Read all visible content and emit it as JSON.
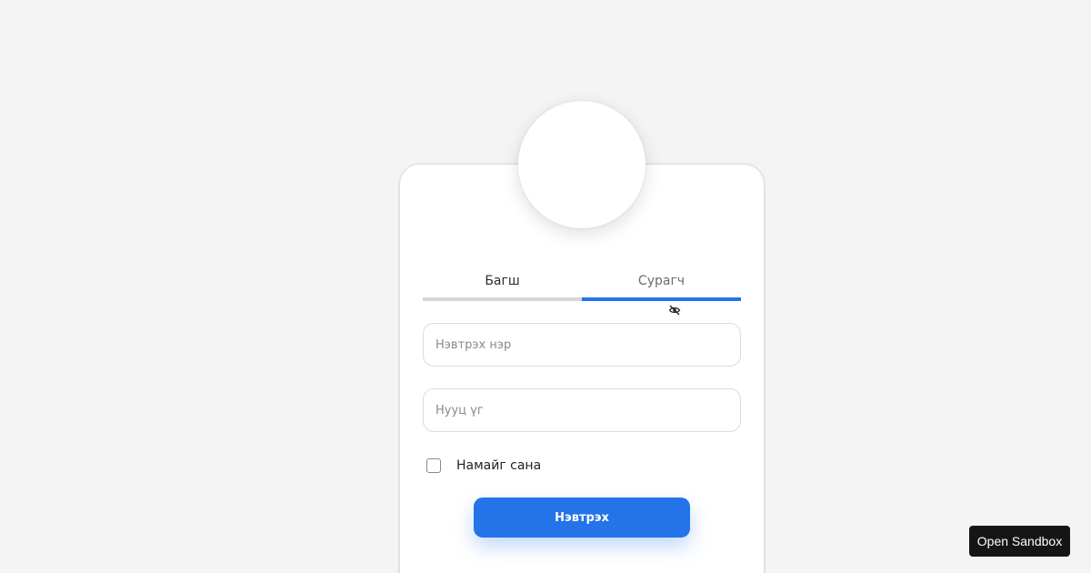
{
  "login": {
    "tabs": [
      {
        "label": "Багш",
        "active": false
      },
      {
        "label": "Сурагч",
        "active": true
      }
    ],
    "username": {
      "placeholder": "Нэвтрэх нэр",
      "value": ""
    },
    "password": {
      "placeholder": "Нууц үг",
      "value": ""
    },
    "remember_label": "Намайг сана",
    "remember_checked": false,
    "submit_label": "Нэвтрэх"
  },
  "sandbox_label": "Open Sandbox",
  "icons": {
    "password_toggle": "eye-off-icon"
  },
  "colors": {
    "accent": "#2473e8",
    "background": "#f4f4f4",
    "card": "#ffffff",
    "sandbox_button": "#151515"
  }
}
